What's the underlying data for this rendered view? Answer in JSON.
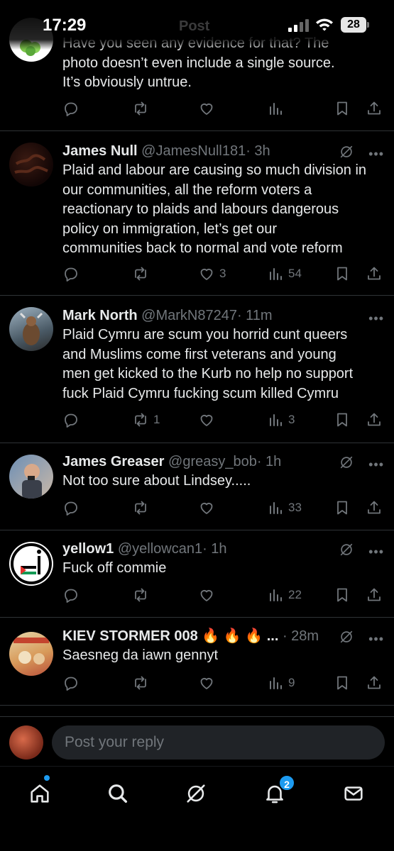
{
  "status_bar": {
    "time": "17:29",
    "title": "Post",
    "battery": "28"
  },
  "top_tweet": {
    "lines": [
      "Have you seen any evidence for that? The",
      "photo doesn’t even include a single source.",
      "It’s obviously untrue."
    ]
  },
  "tweets": [
    {
      "name": "James Null",
      "handle": "@JamesNull181",
      "time": "· 3h",
      "lines": [
        "Plaid and labour are causing so much division in",
        "our communities, all the reform voters a",
        "reactionary to plaids and labours dangerous",
        "policy on immigration, let’s get our",
        "communities back to normal and vote reform"
      ],
      "replies": "",
      "reposts": "",
      "likes": "3",
      "views": "54"
    },
    {
      "name": "Mark North",
      "handle": "@MarkN87247",
      "time": "· 11m",
      "lines": [
        "Plaid Cymru are scum you horrid cunt queers",
        "and Muslims come first veterans and young",
        "men get kicked to the Kurb no help no support",
        "fuck Plaid Cymru fucking scum killed Cymru"
      ],
      "replies": "",
      "reposts": "1",
      "likes": "",
      "views": "3"
    },
    {
      "name": "James Greaser",
      "handle": "@greasy_bob",
      "time": "· 1h",
      "lines": [
        "Not too sure about Lindsey....."
      ],
      "replies": "",
      "reposts": "",
      "likes": "",
      "views": "33"
    },
    {
      "name": "yellow1",
      "handle": "@yellowcan1",
      "time": "· 1h",
      "lines": [
        "Fuck off commie"
      ],
      "replies": "",
      "reposts": "",
      "likes": "",
      "views": "22"
    },
    {
      "name": "KIEV STORMER 008 🔥 🔥 🔥 ...",
      "handle": "",
      "time": "· 28m",
      "lines": [
        "Saesneg da iawn gennyt"
      ],
      "replies": "",
      "reposts": "",
      "likes": "",
      "views": "9"
    }
  ],
  "reply": {
    "placeholder": "Post your reply"
  },
  "tabbar": {
    "notifications_badge": "2"
  },
  "colors": {
    "accent": "#1d9bf0",
    "muted": "#71767b",
    "text": "#e7e9ea",
    "divider": "#2f3336"
  }
}
